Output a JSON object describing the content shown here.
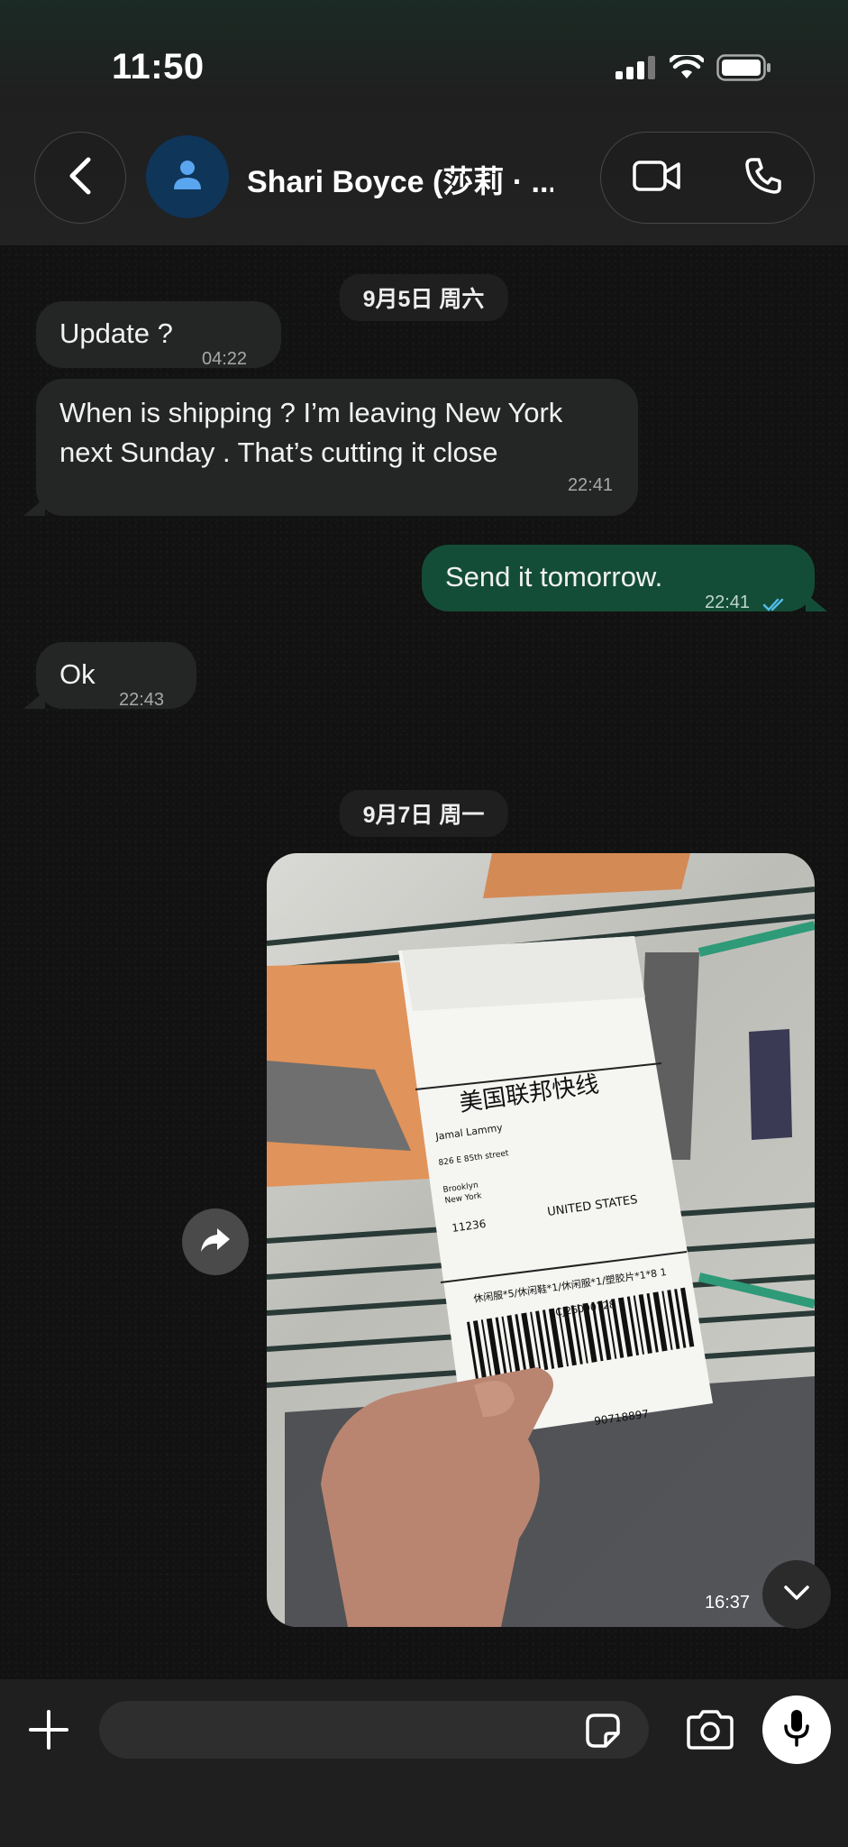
{
  "status_bar": {
    "time": "11:50",
    "signal_icon": "cellular-signal-icon",
    "wifi_icon": "wifi-icon",
    "battery_icon": "battery-icon"
  },
  "header": {
    "back_icon": "chevron-left-icon",
    "avatar_icon": "person-icon",
    "contact_name": "Shari Boyce (莎莉 · ...",
    "video_icon": "video-camera-icon",
    "call_icon": "phone-icon"
  },
  "messages": [
    {
      "date": "9月5日 周六"
    },
    {
      "dir": "in",
      "text": "Update ?",
      "time": "04:22"
    },
    {
      "dir": "in",
      "lines": [
        "When is shipping ? I’m leaving New York",
        "next Sunday . That’s cutting it close"
      ],
      "time": "22:41"
    },
    {
      "dir": "out",
      "text": "Send it tomorrow.",
      "time": "22:41",
      "read_icon": "double-check-icon"
    },
    {
      "dir": "in",
      "text": "Ok",
      "time": "22:43"
    },
    {
      "date": "9月7日 周一"
    }
  ],
  "photo_message": {
    "time": "16:37",
    "label": {
      "carrier": "美国联邦快线",
      "name": "Jamal Lammy",
      "street": "826 E 85th street",
      "city": "Brooklyn",
      "state": "New York",
      "zip": "11236",
      "country": "UNITED STATES",
      "contents": "休闲服*5/休闲鞋*1/休闲服*1/塑胶片*1*8 1",
      "ref": "1CJ26090728",
      "tracking": "90718897"
    }
  },
  "composer": {
    "add_icon": "plus-icon",
    "sticker_icon": "sticker-icon",
    "camera_icon": "camera-icon",
    "mic_icon": "microphone-icon",
    "forward_icon": "forward-icon",
    "scroll_icon": "chevron-down-icon"
  }
}
